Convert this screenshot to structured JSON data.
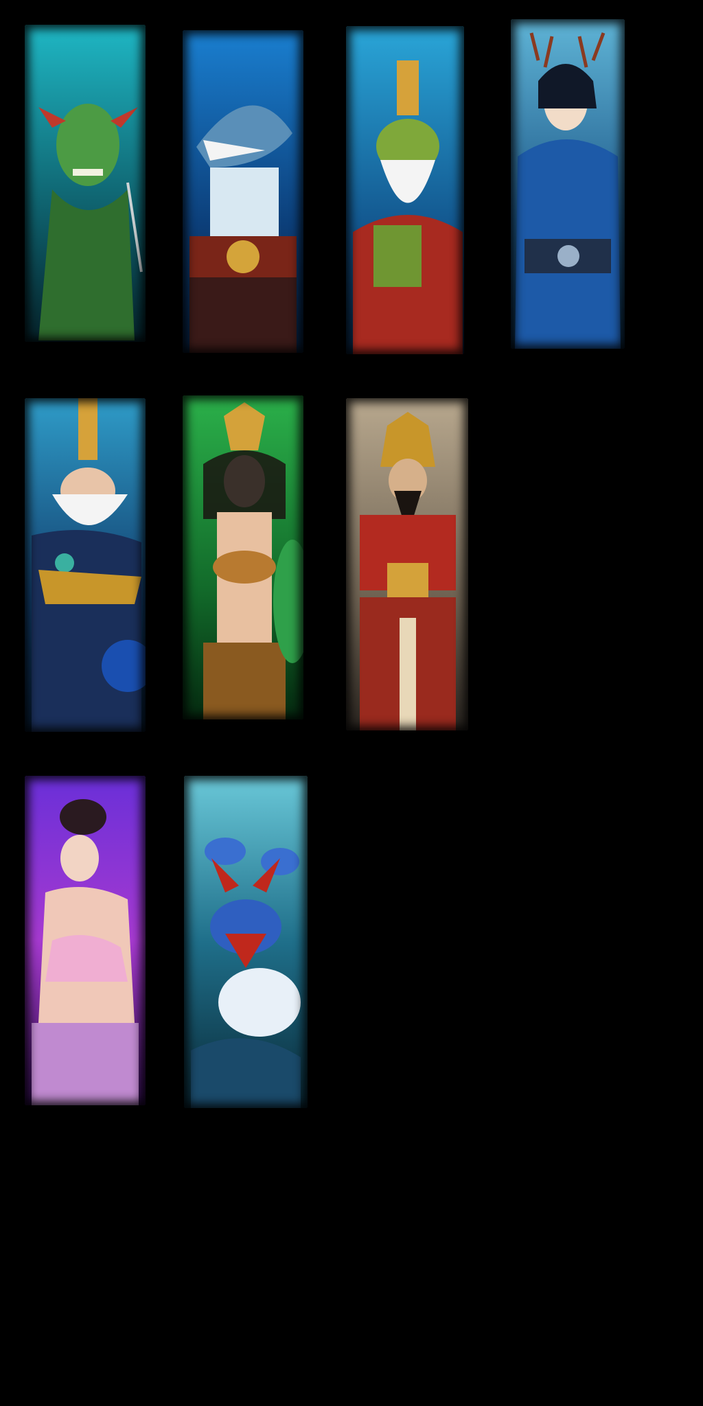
{
  "sheet": {
    "background": "#000000",
    "cards": [
      {
        "character": "green-goblin-warrior-portrait",
        "row": 1,
        "col": 1,
        "palette": [
          "#1fb7c4",
          "#0a3a44",
          "#3e8f3a"
        ]
      },
      {
        "character": "shark-warrior-portrait",
        "row": 1,
        "col": 2,
        "palette": [
          "#1a7fd0",
          "#0a2a55",
          "#b0d8f0"
        ]
      },
      {
        "character": "frog-elder-portrait",
        "row": 1,
        "col": 3,
        "palette": [
          "#2aa6d8",
          "#0c3560",
          "#c8962a"
        ]
      },
      {
        "character": "dragon-prince-portrait",
        "row": 1,
        "col": 4,
        "palette": [
          "#5fb4d6",
          "#123a62",
          "#1d5aa8"
        ]
      },
      {
        "character": "dragon-king-elder-portrait",
        "row": 2,
        "col": 1,
        "palette": [
          "#2f9cc8",
          "#0b2b4e",
          "#d6a23a"
        ]
      },
      {
        "character": "peacock-maiden-portrait",
        "row": 2,
        "col": 2,
        "palette": [
          "#2bb04a",
          "#0a3a18",
          "#d1a05a"
        ]
      },
      {
        "character": "armored-general-portrait",
        "row": 2,
        "col": 3,
        "palette": [
          "#9c8a72",
          "#2a2520",
          "#b32a20"
        ]
      },
      {
        "character": "violet-fairy-portrait",
        "row": 3,
        "col": 1,
        "palette": [
          "#8a2fd8",
          "#2a0b55",
          "#f0a8d8"
        ]
      },
      {
        "character": "hydra-beast-portrait",
        "row": 3,
        "col": 2,
        "palette": [
          "#2f8fb0",
          "#0a2a38",
          "#3a6fd0"
        ]
      }
    ]
  }
}
